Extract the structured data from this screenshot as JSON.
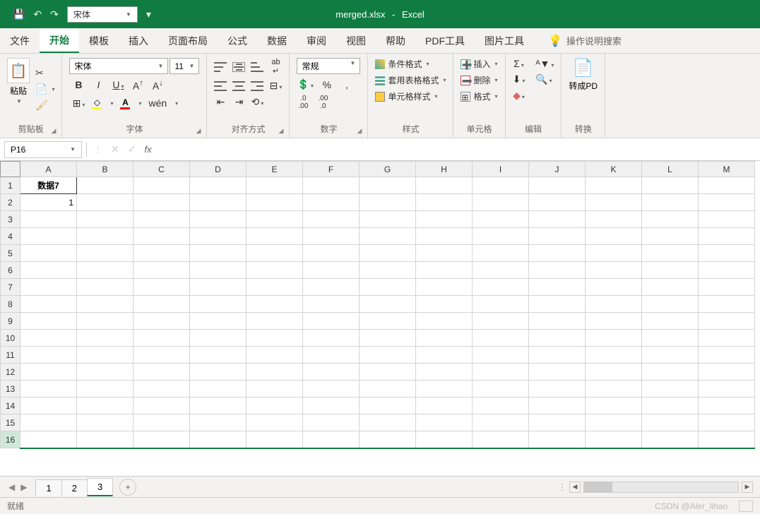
{
  "title": {
    "filename": "merged.xlsx",
    "app": "Excel"
  },
  "qat": {
    "font": "宋体"
  },
  "tabs": {
    "file": "文件",
    "home": "开始",
    "template": "模板",
    "insert": "插入",
    "layout": "页面布局",
    "formula": "公式",
    "data": "数据",
    "review": "审阅",
    "view": "视图",
    "help": "帮助",
    "pdf": "PDF工具",
    "pic": "图片工具",
    "tellme": "操作说明搜索"
  },
  "ribbon": {
    "clipboard": {
      "label": "剪贴板",
      "paste": "粘贴"
    },
    "font": {
      "label": "字体",
      "name": "宋体",
      "size": "11",
      "ruby": "wén"
    },
    "align": {
      "label": "对齐方式"
    },
    "number": {
      "label": "数字",
      "format": "常规"
    },
    "styles": {
      "label": "样式",
      "cond": "条件格式",
      "table": "套用表格格式",
      "cell": "单元格样式"
    },
    "cells": {
      "label": "单元格",
      "insert": "插入",
      "delete": "删除",
      "format": "格式"
    },
    "editing": {
      "label": "编辑"
    },
    "convert": {
      "label": "转换",
      "pdf": "转成PD"
    }
  },
  "refbar": {
    "cell": "P16",
    "fx": "fx"
  },
  "grid": {
    "cols": [
      "A",
      "B",
      "C",
      "D",
      "E",
      "F",
      "G",
      "H",
      "I",
      "J",
      "K",
      "L",
      "M"
    ],
    "rows": [
      "1",
      "2",
      "3",
      "4",
      "5",
      "6",
      "7",
      "8",
      "9",
      "10",
      "11",
      "12",
      "13",
      "14",
      "15",
      "16"
    ],
    "cells": {
      "A1": "数据7",
      "A2": "1"
    }
  },
  "sheets": {
    "tabs": [
      "1",
      "2",
      "3"
    ],
    "active": 2
  },
  "status": {
    "ready": "就绪",
    "watermark": "CSDN @Aler_lihao"
  }
}
